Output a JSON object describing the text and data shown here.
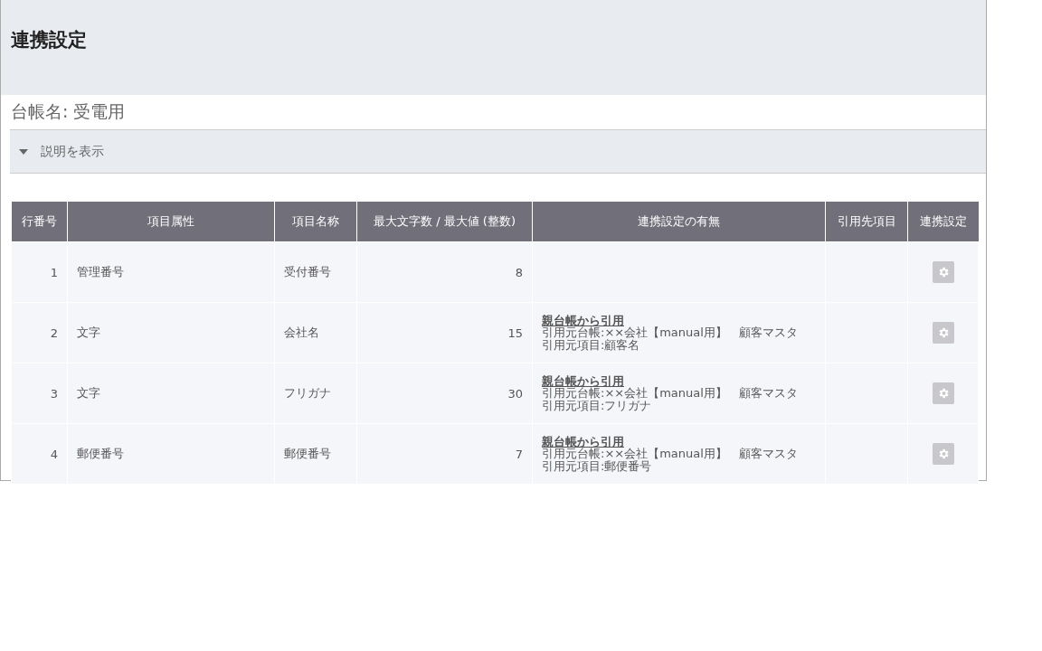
{
  "page": {
    "title": "連携設定",
    "ledger_name": "台帳名: 受電用"
  },
  "explanation": {
    "label": "説明を表示",
    "expanded": false
  },
  "table": {
    "columns": [
      "行番号",
      "項目属性",
      "項目名称",
      "最大文字数 / 最大値 (整数)",
      "連携設定の有無",
      "引用先項目",
      "連携設定"
    ],
    "rows": [
      {
        "row_number": "1",
        "attribute": "管理番号",
        "name": "受付番号",
        "max": "8"
      },
      {
        "row_number": "2",
        "attribute": "文字",
        "name": "会社名",
        "max": "15",
        "linkage": {
          "link": "親台帳から引用",
          "source_ledger": "引用元台帳:××会社【manual用】　顧客マスタ",
          "source_item": "引用元項目:顧客名"
        }
      },
      {
        "row_number": "3",
        "attribute": "文字",
        "name": "フリガナ",
        "max": "30",
        "linkage": {
          "link": "親台帳から引用",
          "source_ledger": "引用元台帳:××会社【manual用】　顧客マスタ",
          "source_item": "引用元項目:フリガナ"
        }
      },
      {
        "row_number": "4",
        "attribute": "郵便番号",
        "name": "郵便番号",
        "max": "7",
        "linkage": {
          "link": "親台帳から引用",
          "source_ledger": "引用元台帳:××会社【manual用】　顧客マスタ",
          "source_item": "引用元項目:郵便番号"
        }
      }
    ]
  }
}
